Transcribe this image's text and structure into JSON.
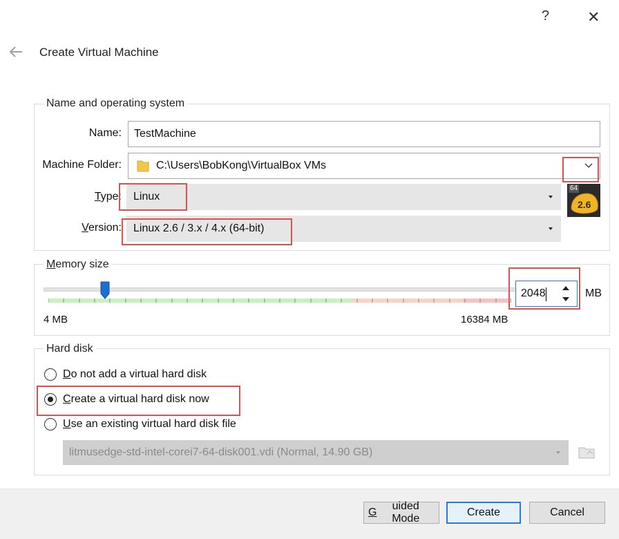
{
  "titlebar": {
    "help": "?",
    "close": "✕"
  },
  "wizard": {
    "title": "Create Virtual Machine"
  },
  "name_os": {
    "group_title": "Name and operating system",
    "name_label": "Name:",
    "name_value": "TestMachine",
    "folder_label": "Machine Folder:",
    "folder_value": "C:\\Users\\BobKong\\VirtualBox VMs",
    "type_label_u": "T",
    "type_label_rest": "ype:",
    "type_value": "Linux",
    "version_label_u": "V",
    "version_label_rest": "ersion:",
    "version_value": "Linux 2.6 / 3.x / 4.x (64-bit)",
    "os_badge_top": "64",
    "os_badge_main": "2.6"
  },
  "memory": {
    "group_title_u": "M",
    "group_title_rest": "emory size",
    "value": "2048",
    "unit": "MB",
    "min_label": "4 MB",
    "max_label": "16384 MB",
    "min_mb": 4,
    "max_mb": 16384
  },
  "hard_disk": {
    "group_title": "Hard disk",
    "options": [
      {
        "u": "D",
        "rest": "o not add a virtual hard disk",
        "checked": false
      },
      {
        "u": "C",
        "rest": "reate a virtual hard disk now",
        "checked": true
      },
      {
        "u": "U",
        "rest": "se an existing virtual hard disk file",
        "checked": false
      }
    ],
    "existing_file": "litmusedge-std-intel-corei7-64-disk001.vdi (Normal, 14.90 GB)"
  },
  "buttons": {
    "guided_u": "G",
    "guided_rest": "uided Mode",
    "create": "Create",
    "cancel": "Cancel"
  },
  "colors": {
    "accent": "#2a7ad5",
    "highlight": "#e05050",
    "slider_handle": "#1c6fd1"
  }
}
